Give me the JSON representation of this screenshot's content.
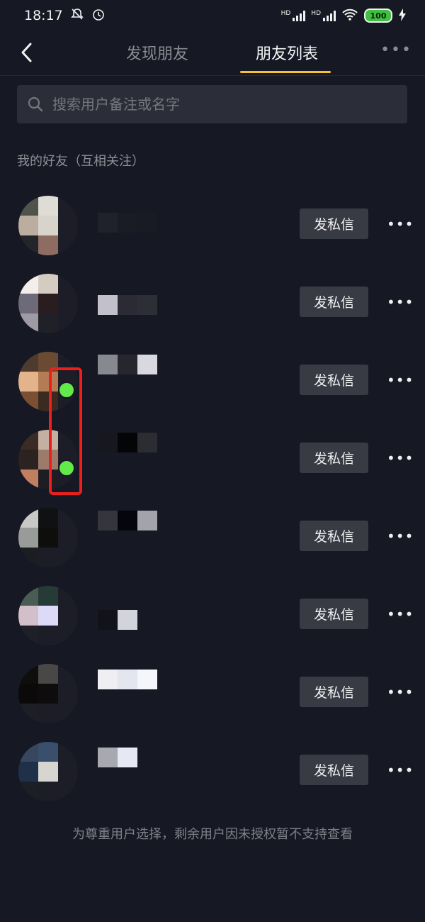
{
  "status_bar": {
    "time": "18:17",
    "battery": "100",
    "net1": "HD",
    "net2": "HD"
  },
  "nav": {
    "tab_discover": "发现朋友",
    "tab_friends": "朋友列表",
    "more": "•••"
  },
  "search": {
    "placeholder": "搜索用户备注或名字"
  },
  "section": {
    "title": "我的好友（互相关注）"
  },
  "friends": [
    {
      "button": "发私信",
      "online": false
    },
    {
      "button": "发私信",
      "online": false
    },
    {
      "button": "发私信",
      "online": true
    },
    {
      "button": "发私信",
      "online": true
    },
    {
      "button": "发私信",
      "online": false
    },
    {
      "button": "发私信",
      "online": false
    },
    {
      "button": "发私信",
      "online": false
    },
    {
      "button": "发私信",
      "online": false
    }
  ],
  "footer": {
    "note": "为尊重用户选择，剩余用户因未授权暂不支持查看"
  },
  "colors": {
    "background": "#161823",
    "accent_underline": "#f5c130",
    "online": "#62ea4a",
    "highlight": "#f01d1d"
  }
}
